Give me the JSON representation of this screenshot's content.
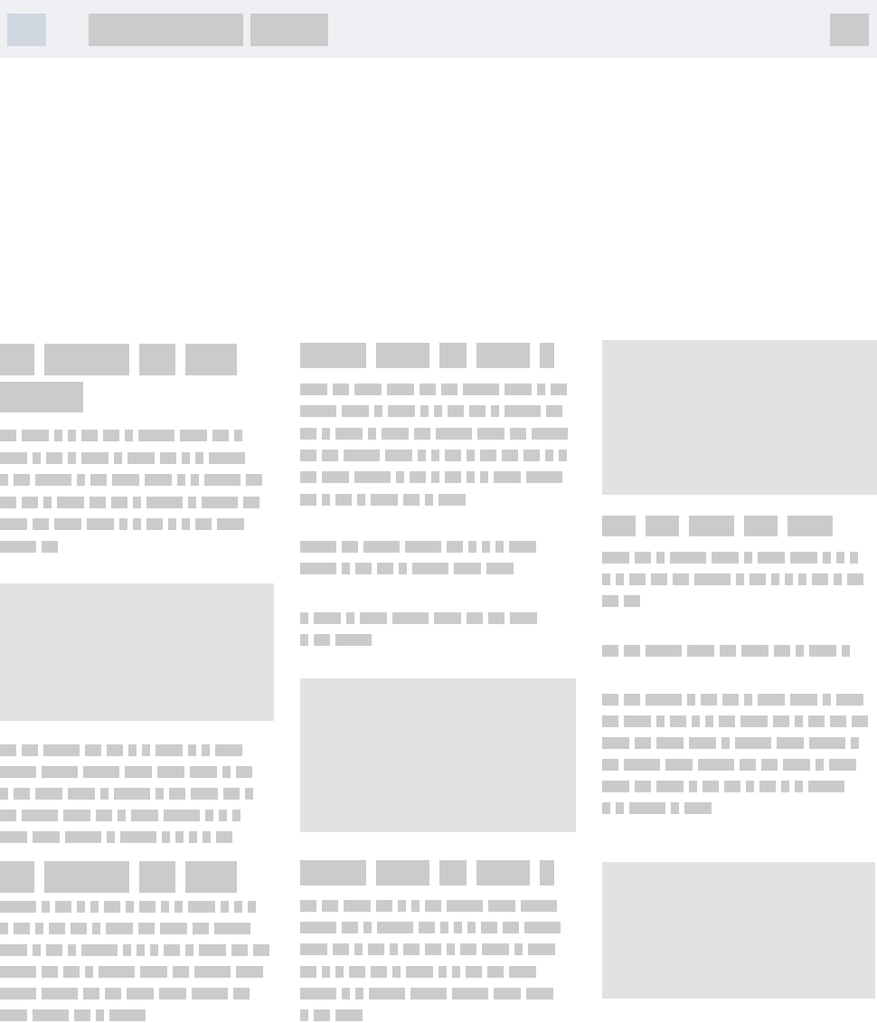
{
  "colors": {
    "topbar_bg": "#eef0f4",
    "logo_block": "#d0d7e0",
    "placeholder_text": "#cbcbcb",
    "placeholder_image": "#e2e2e5",
    "page_bg": "#ffffff"
  },
  "topbar": {
    "logo": "",
    "nav_items": [
      "",
      ""
    ],
    "action": ""
  },
  "columns": [
    {
      "blocks": [
        {
          "kind": "heading"
        },
        {
          "kind": "paragraph"
        },
        {
          "kind": "image"
        },
        {
          "kind": "paragraph"
        },
        {
          "kind": "heading"
        },
        {
          "kind": "paragraph"
        }
      ]
    },
    {
      "blocks": [
        {
          "kind": "heading"
        },
        {
          "kind": "paragraph"
        },
        {
          "kind": "paragraph"
        },
        {
          "kind": "paragraph"
        },
        {
          "kind": "image"
        },
        {
          "kind": "heading"
        },
        {
          "kind": "paragraph"
        }
      ]
    },
    {
      "blocks": [
        {
          "kind": "image"
        },
        {
          "kind": "heading"
        },
        {
          "kind": "paragraph"
        },
        {
          "kind": "paragraph"
        },
        {
          "kind": "paragraph"
        },
        {
          "kind": "image"
        }
      ]
    }
  ]
}
